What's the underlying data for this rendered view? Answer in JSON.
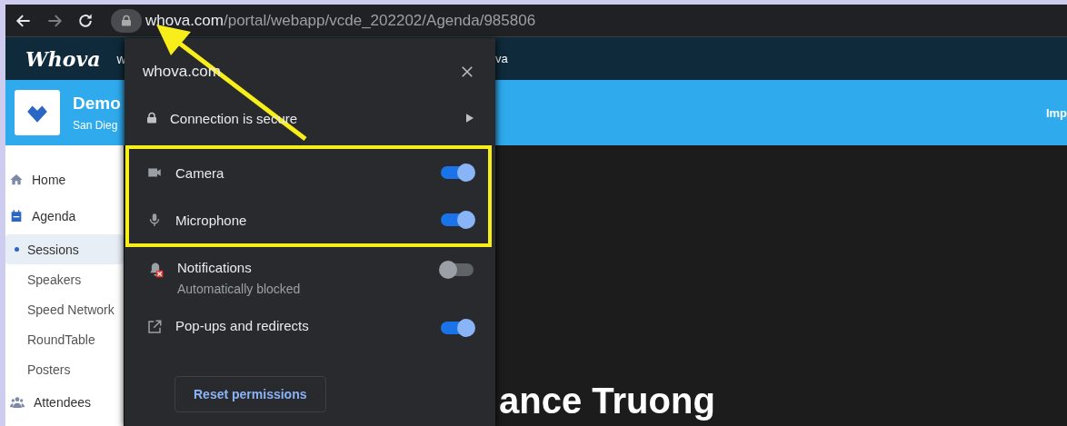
{
  "browser": {
    "url": {
      "domain": "whova.com",
      "path": "/portal/webapp/vcde_202202/Agenda/985806"
    }
  },
  "site_header": {
    "logo": "Whova",
    "left_text": "w",
    "right_text": "va"
  },
  "event_banner": {
    "title": "Demo",
    "subtitle": "San Dieg",
    "right_link": "Imp"
  },
  "sidebar": {
    "items": [
      {
        "label": "Home",
        "selected": false
      },
      {
        "label": "Agenda",
        "selected": false,
        "children": [
          {
            "label": "Sessions",
            "selected": true
          },
          {
            "label": "Speakers",
            "selected": false
          },
          {
            "label": "Speed Network",
            "selected": false
          },
          {
            "label": "RoundTable",
            "selected": false
          },
          {
            "label": "Posters",
            "selected": false
          }
        ]
      },
      {
        "label": "Attendees",
        "selected": false
      }
    ]
  },
  "popup": {
    "site": "whova.com",
    "connection": "Connection is secure",
    "permissions": [
      {
        "label": "Camera",
        "on": true,
        "highlighted": true
      },
      {
        "label": "Microphone",
        "on": true,
        "highlighted": true
      },
      {
        "label": "Notifications",
        "sublabel": "Automatically blocked",
        "on": false,
        "highlighted": false
      },
      {
        "label": "Pop-ups and redirects",
        "on": true,
        "highlighted": false
      }
    ],
    "reset_button": "Reset permissions"
  },
  "main": {
    "speaker_name": "ance Truong"
  }
}
